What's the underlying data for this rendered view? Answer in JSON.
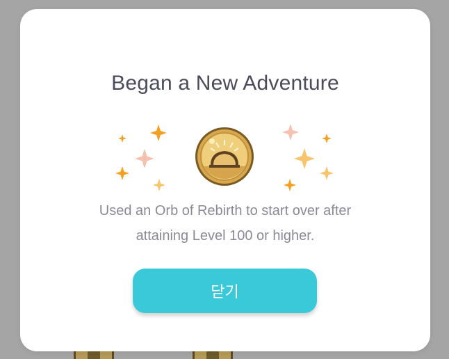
{
  "dialog": {
    "title": "Began a New Adventure",
    "description_line1": "Used an Orb of Rebirth to start over after",
    "description_line2": "attaining Level 100 or higher.",
    "close_label": "닫기"
  },
  "icons": {
    "centerpiece": "orb-of-rebirth-icon",
    "decoration": "sparkle-icon"
  },
  "colors": {
    "accent": "#3ac9d8",
    "sparkle_orange": "#f4a023",
    "sparkle_pink": "#f7c1b0",
    "orb_gold": "#e8c36a"
  }
}
